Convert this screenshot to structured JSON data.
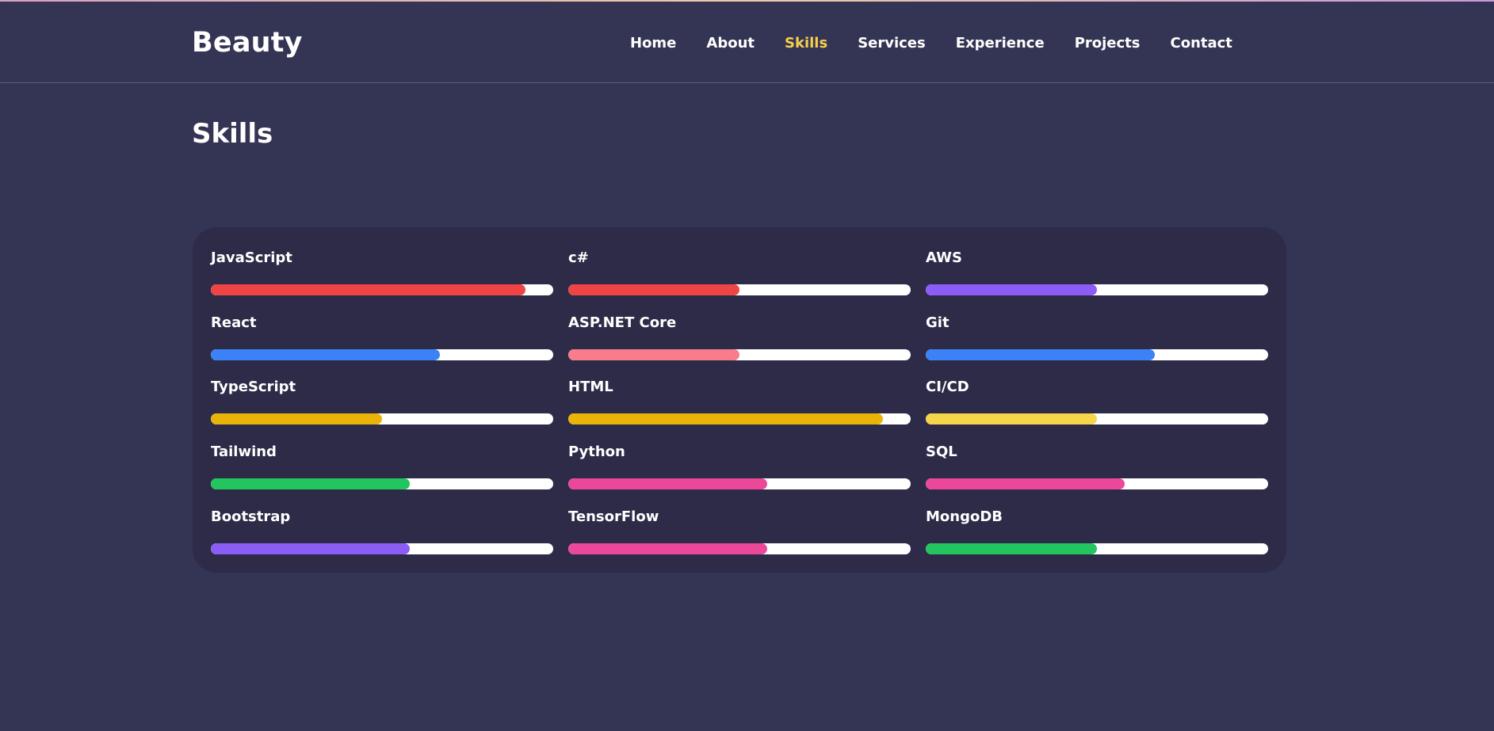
{
  "brand": "Beauty",
  "nav": [
    {
      "label": "Home",
      "active": false
    },
    {
      "label": "About",
      "active": false
    },
    {
      "label": "Skills",
      "active": true
    },
    {
      "label": "Services",
      "active": false
    },
    {
      "label": "Experience",
      "active": false
    },
    {
      "label": "Projects",
      "active": false
    },
    {
      "label": "Contact",
      "active": false
    }
  ],
  "page_title": "Skills",
  "skills": [
    {
      "name": "JavaScript",
      "level": 0.92,
      "color": "#ef4444"
    },
    {
      "name": "c#",
      "level": 0.5,
      "color": "#ef4444"
    },
    {
      "name": "AWS",
      "level": 0.5,
      "color": "#8b5cf6"
    },
    {
      "name": "React",
      "level": 0.67,
      "color": "#3b82f6"
    },
    {
      "name": "ASP.NET Core",
      "level": 0.5,
      "color": "#f87c8c"
    },
    {
      "name": "Git",
      "level": 0.67,
      "color": "#3b82f6"
    },
    {
      "name": "TypeScript",
      "level": 0.5,
      "color": "#eab308"
    },
    {
      "name": "HTML",
      "level": 0.92,
      "color": "#eab308"
    },
    {
      "name": "CI/CD",
      "level": 0.5,
      "color": "#f6d54a"
    },
    {
      "name": "Tailwind",
      "level": 0.58,
      "color": "#22c55e"
    },
    {
      "name": "Python",
      "level": 0.58,
      "color": "#ec4899"
    },
    {
      "name": "SQL",
      "level": 0.58,
      "color": "#ec4899"
    },
    {
      "name": "Bootstrap",
      "level": 0.58,
      "color": "#8b5cf6"
    },
    {
      "name": "TensorFlow",
      "level": 0.58,
      "color": "#ec4899"
    },
    {
      "name": "MongoDB",
      "level": 0.5,
      "color": "#22c55e"
    }
  ],
  "colors": {
    "background": "#343454",
    "card": "#2d2b48",
    "accent": "#f6d04d",
    "text": "#ffffff",
    "track": "#ffffff"
  }
}
